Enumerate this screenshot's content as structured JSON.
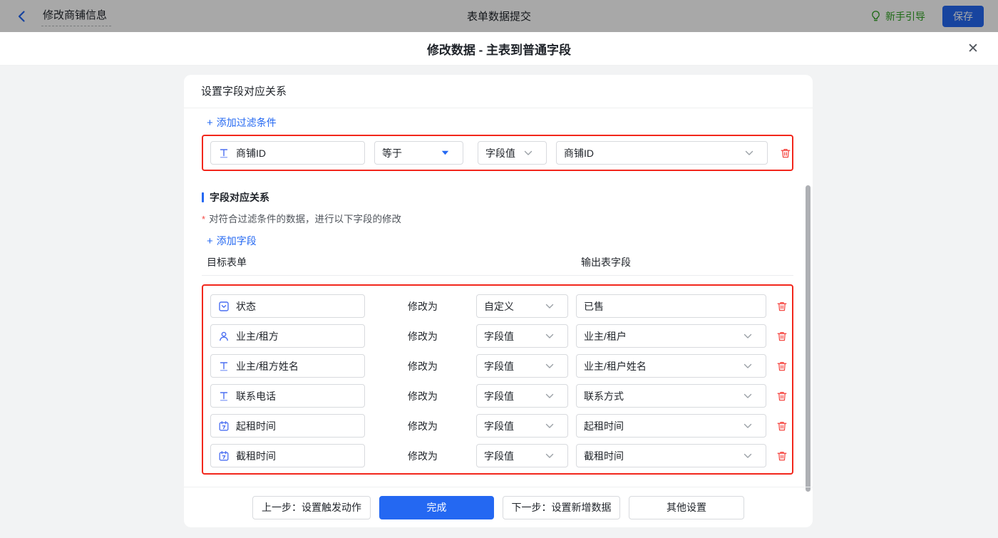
{
  "topbar": {
    "back_title": "修改商铺信息",
    "center_title": "表单数据提交",
    "guide_label": "新手引导",
    "save_label": "保存"
  },
  "modal": {
    "title": "修改数据 - 主表到普通字段",
    "close_glyph": "✕"
  },
  "card": {
    "header": "设置字段对应关系",
    "add_filter_label": "添加过滤条件",
    "add_field_label": "添加字段",
    "plus_glyph": "+",
    "filter_row": {
      "field": "商铺ID",
      "field_icon": "text-field-icon",
      "operator": "等于",
      "value_type": "字段值",
      "value": "商铺ID"
    },
    "section": {
      "title": "字段对应关系",
      "required_mark": "*",
      "description": "对符合过滤条件的数据，进行以下字段的修改"
    },
    "columns": {
      "left": "目标表单",
      "right": "输出表字段"
    },
    "modify_label": "修改为",
    "mappings": [
      {
        "field": "状态",
        "icon": "select-field-icon",
        "type": "自定义",
        "value": "已售",
        "value_kind": "input"
      },
      {
        "field": "业主/租方",
        "icon": "person-icon",
        "type": "字段值",
        "value": "业主/租户",
        "value_kind": "select"
      },
      {
        "field": "业主/租方姓名",
        "icon": "text-field-icon",
        "type": "字段值",
        "value": "业主/租户姓名",
        "value_kind": "select"
      },
      {
        "field": "联系电话",
        "icon": "text-field-icon",
        "type": "字段值",
        "value": "联系方式",
        "value_kind": "select"
      },
      {
        "field": "起租时间",
        "icon": "date-icon",
        "type": "字段值",
        "value": "起租时间",
        "value_kind": "select"
      },
      {
        "field": "截租时间",
        "icon": "date-icon",
        "type": "字段值",
        "value": "截租时间",
        "value_kind": "select"
      }
    ],
    "footer": {
      "prev": "上一步：设置触发动作",
      "done": "完成",
      "next": "下一步：设置新增数据",
      "other": "其他设置"
    }
  },
  "colors": {
    "accent_blue": "#2468f2",
    "highlight_red": "#f2271c",
    "trash_red": "#f54a45",
    "guide_green": "#2ea121",
    "field_icon_blue": "#4a6ef2"
  }
}
